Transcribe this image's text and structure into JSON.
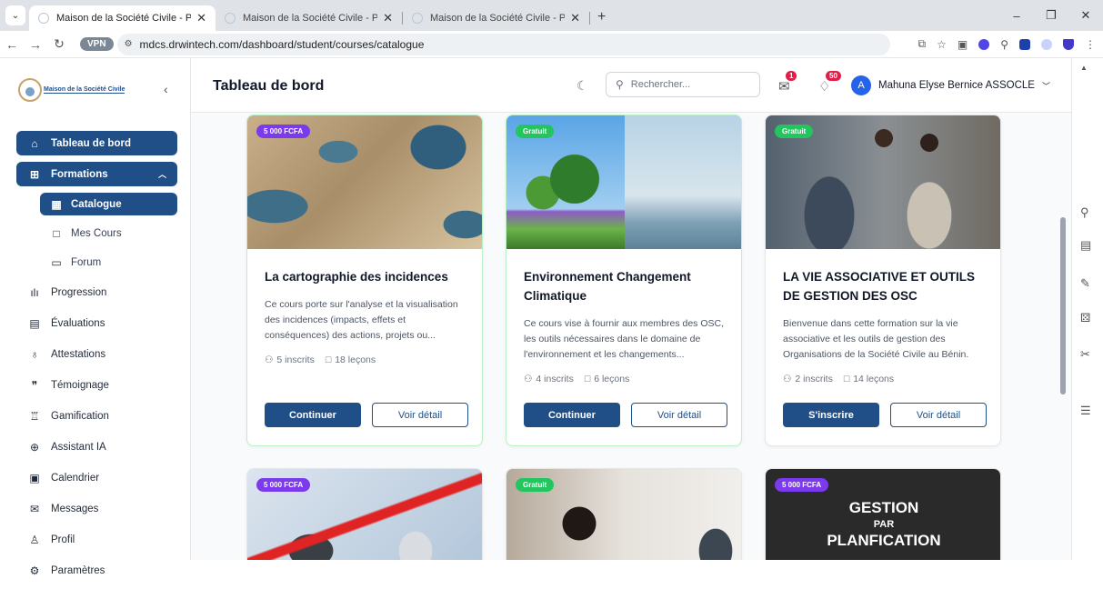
{
  "browser": {
    "tabs": [
      {
        "title": "Maison de la Société Civile - Pl",
        "active": true
      },
      {
        "title": "Maison de la Société Civile - Pl",
        "active": false
      },
      {
        "title": "Maison de la Société Civile - Pl",
        "active": false
      }
    ],
    "vpn_label": "VPN",
    "url": "mdcs.drwintech.com/dashboard/student/courses/catalogue"
  },
  "sidebar": {
    "logo_text": "Maison de la Société Civile",
    "items": [
      {
        "label": "Tableau de bord",
        "icon": "home-icon"
      },
      {
        "label": "Formations",
        "icon": "book-open-icon"
      },
      {
        "label": "Catalogue",
        "icon": "grid-icon"
      },
      {
        "label": "Mes Cours",
        "icon": "book-icon"
      },
      {
        "label": "Forum",
        "icon": "chat-icon"
      },
      {
        "label": "Progression",
        "icon": "bar-chart-icon"
      },
      {
        "label": "Évaluations",
        "icon": "file-text-icon"
      },
      {
        "label": "Attestations",
        "icon": "award-icon"
      },
      {
        "label": "Témoignage",
        "icon": "quote-icon"
      },
      {
        "label": "Gamification",
        "icon": "trophy-icon"
      },
      {
        "label": "Assistant IA",
        "icon": "brain-icon"
      },
      {
        "label": "Calendrier",
        "icon": "calendar-icon"
      },
      {
        "label": "Messages",
        "icon": "mail-icon"
      },
      {
        "label": "Profil",
        "icon": "user-icon"
      },
      {
        "label": "Paramètres",
        "icon": "gear-icon"
      }
    ]
  },
  "header": {
    "title": "Tableau de bord",
    "search_placeholder": "Rechercher...",
    "messages_badge": "1",
    "notifications_badge": "50",
    "user_name": "Mahuna Elyse Bernice ASSOCLE",
    "user_initial": "A"
  },
  "courses": [
    {
      "price": "5 000 FCFA",
      "free": false,
      "title": "La cartographie des incidences",
      "description": "Ce cours porte sur l'analyse et la visualisation des incidences (impacts, effets et conséquences) des actions, projets ou...",
      "inscrits": "5 inscrits",
      "lecons": "18 leçons",
      "primary": "Continuer",
      "secondary": "Voir détail"
    },
    {
      "price": "Gratuit",
      "free": true,
      "title": "Environnement Changement Climatique",
      "description": "Ce cours vise à fournir aux membres des OSC, les outils nécessaires dans le domaine de l'environnement et les changements...",
      "inscrits": "4 inscrits",
      "lecons": "6 leçons",
      "primary": "Continuer",
      "secondary": "Voir détail"
    },
    {
      "price": "Gratuit",
      "free": true,
      "title": "LA VIE ASSOCIATIVE ET OUTILS DE GESTION DES OSC",
      "description": "Bienvenue dans cette formation sur la vie associative et les outils de gestion des Organisations de la Société Civile au Bénin.",
      "inscrits": "2 inscrits",
      "lecons": "14 leçons",
      "primary": "S'inscrire",
      "secondary": "Voir détail"
    },
    {
      "price": "5 000 FCFA",
      "free": false
    },
    {
      "price": "Gratuit",
      "free": true
    },
    {
      "price": "5 000 FCFA",
      "free": false,
      "image_text": [
        "GESTION",
        "PAR",
        "PLANFICATION"
      ]
    }
  ],
  "colors": {
    "primary": "#204f88",
    "paid_badge": "#7c3aed",
    "free_badge": "#22c55e",
    "notification": "#e11d48"
  }
}
